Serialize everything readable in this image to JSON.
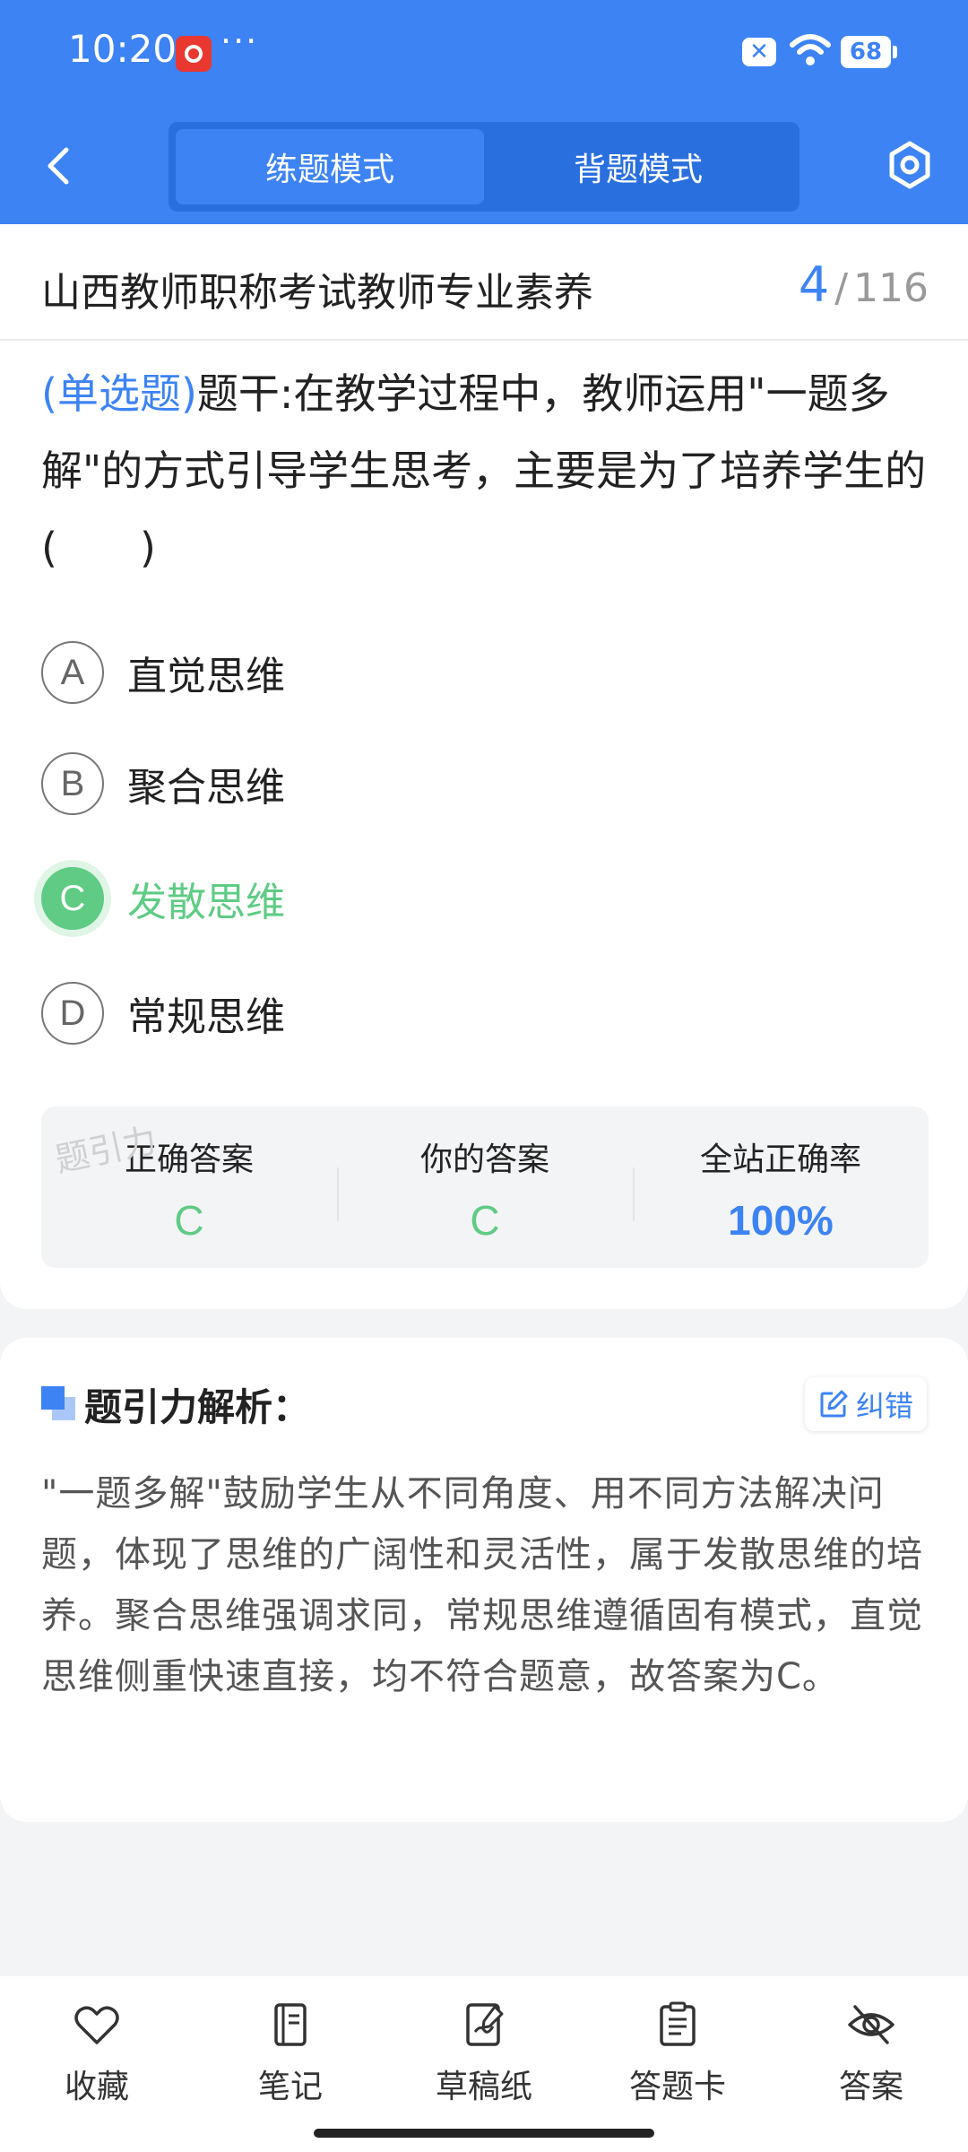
{
  "status_bar": {
    "time": "10:20",
    "more": "···",
    "battery": "68"
  },
  "header": {
    "tabs": [
      {
        "label": "练题模式",
        "active": true
      },
      {
        "label": "背题模式",
        "active": false
      }
    ]
  },
  "question": {
    "exam_title": "山西教师职称考试教师专业素养",
    "progress_current": "4",
    "progress_separator": "/",
    "progress_total": "116",
    "type": "(单选题)",
    "text": "题干:在教学过程中，教师运用\"一题多解\"的方式引导学生思考，主要是为了培养学生的(　　)",
    "options": [
      {
        "letter": "A",
        "text": "直觉思维"
      },
      {
        "letter": "B",
        "text": "聚合思维"
      },
      {
        "letter": "C",
        "text": "发散思维"
      },
      {
        "letter": "D",
        "text": "常规思维"
      }
    ]
  },
  "stats": {
    "correct_answer_label": "正确答案",
    "correct_answer": "C",
    "your_answer_label": "你的答案",
    "your_answer": "C",
    "accuracy_label": "全站正确率",
    "accuracy": "100%",
    "watermark": "题引力"
  },
  "analysis": {
    "title": "题引力解析：",
    "correct_button": "纠错",
    "text": "\"一题多解\"鼓励学生从不同角度、用不同方法解决问题，体现了思维的广阔性和灵活性，属于发散思维的培养。聚合思维强调求同，常规思维遵循固有模式，直觉思维侧重快速直接，均不符合题意，故答案为C。"
  },
  "bottom_bar": {
    "items": [
      {
        "label": "收藏",
        "icon": "heart-icon"
      },
      {
        "label": "笔记",
        "icon": "notebook-icon"
      },
      {
        "label": "草稿纸",
        "icon": "draft-icon"
      },
      {
        "label": "答题卡",
        "icon": "answer-sheet-icon"
      },
      {
        "label": "答案",
        "icon": "eye-off-icon"
      }
    ]
  },
  "colors": {
    "brand": "#3d83f3",
    "correct": "#5fcb84"
  }
}
